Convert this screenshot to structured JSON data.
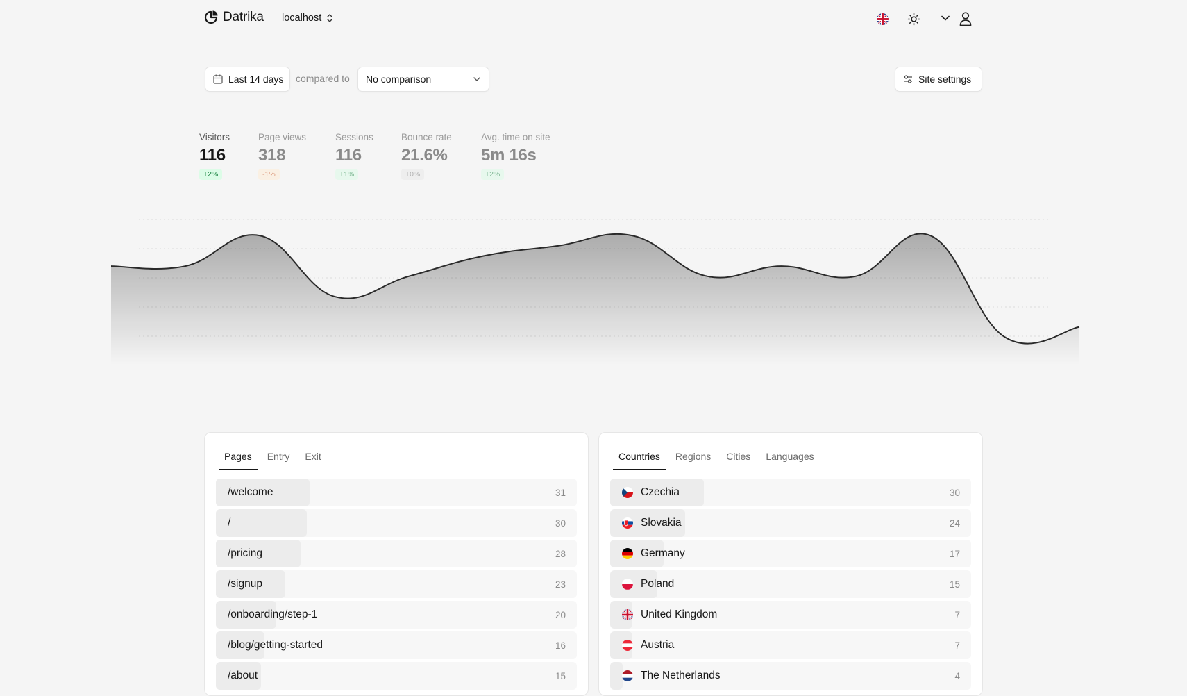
{
  "header": {
    "brand": "Datrika",
    "site": "localhost"
  },
  "toolbar": {
    "date_range": "Last 14 days",
    "compared_to": "compared to",
    "comparison": "No comparison",
    "settings": "Site settings"
  },
  "metrics": [
    {
      "label": "Visitors",
      "value": "116",
      "change": "+2%",
      "trend": "pos",
      "active": true
    },
    {
      "label": "Page views",
      "value": "318",
      "change": "-1%",
      "trend": "neg",
      "active": false
    },
    {
      "label": "Sessions",
      "value": "116",
      "change": "+1%",
      "trend": "pos",
      "active": false
    },
    {
      "label": "Bounce rate",
      "value": "21.6%",
      "change": "+0%",
      "trend": "neu",
      "active": false
    },
    {
      "label": "Avg. time on site",
      "value": "5m 16s",
      "change": "+2%",
      "trend": "pos",
      "active": false
    }
  ],
  "chart_data": {
    "type": "area",
    "series": [
      {
        "values": [
          4,
          4,
          7,
          1,
          3,
          5,
          6,
          7,
          3,
          4,
          3,
          7,
          -3,
          -2
        ]
      }
    ],
    "ylim": [
      -4,
      9
    ],
    "grid": true
  },
  "pages_panel": {
    "tabs": [
      "Pages",
      "Entry",
      "Exit"
    ],
    "active_tab": 0,
    "rows": [
      {
        "label": "/welcome",
        "value": "31"
      },
      {
        "label": "/",
        "value": "30"
      },
      {
        "label": "/pricing",
        "value": "28"
      },
      {
        "label": "/signup",
        "value": "23"
      },
      {
        "label": "/onboarding/step-1",
        "value": "20"
      },
      {
        "label": "/blog/getting-started",
        "value": "16"
      },
      {
        "label": "/about",
        "value": "15"
      }
    ]
  },
  "locations_panel": {
    "tabs": [
      "Countries",
      "Regions",
      "Cities",
      "Languages"
    ],
    "active_tab": 0,
    "rows": [
      {
        "label": "Czechia",
        "value": "30",
        "flag": "cz-flag"
      },
      {
        "label": "Slovakia",
        "value": "24",
        "flag": "sk-flag"
      },
      {
        "label": "Germany",
        "value": "17",
        "flag": "de-flag"
      },
      {
        "label": "Poland",
        "value": "15",
        "flag": "pl-flag"
      },
      {
        "label": "United Kingdom",
        "value": "7",
        "flag": "gb-flag"
      },
      {
        "label": "Austria",
        "value": "7",
        "flag": "at-flag"
      },
      {
        "label": "The Netherlands",
        "value": "4",
        "flag": "nl-flag"
      }
    ]
  }
}
